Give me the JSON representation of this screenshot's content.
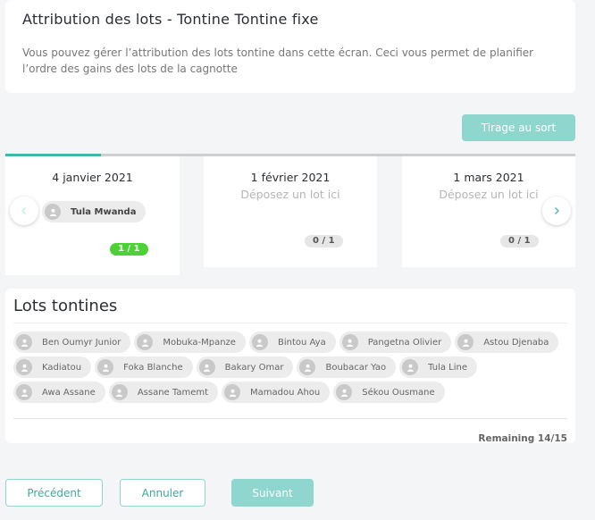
{
  "header": {
    "title": "Attribution des lots - Tontine Tontine fixe",
    "description": "Vous pouvez gérer l’attribution des lots tontine dans cette écran. Ceci vous permet de planifier l’ordre des gains des lots de la cagnotte"
  },
  "actions": {
    "draw_label": "Tirage au sort"
  },
  "progress": {
    "fraction": 0.167
  },
  "lots": [
    {
      "date": "4 janvier 2021",
      "assignee": "Tula Mwanda",
      "count": "1 / 1"
    },
    {
      "date": "1 février 2021",
      "drop_hint": "Déposez un lot ici",
      "count": "0 / 1"
    },
    {
      "date": "1 mars 2021",
      "drop_hint": "Déposez un lot ici",
      "count": "0 / 1"
    }
  ],
  "pool": {
    "title": "Lots tontines",
    "members": [
      "Ben Oumyr Junior",
      "Mobuka-Mpanze",
      "Bintou Aya",
      "Pangetna Olivier",
      "Astou Djenaba",
      "Kadiatou",
      "Foka Blanche",
      "Bakary Omar",
      "Boubacar Yao",
      "Tula Line",
      "Awa Assane",
      "Assane Tamemt",
      "Mamadou Ahou",
      "Sékou Ousmane"
    ],
    "remaining": "Remaining 14/15"
  },
  "footer": {
    "previous_label": "Précédent",
    "cancel_label": "Annuler",
    "next_label": "Suivant"
  },
  "icons": {
    "avatar": "user-icon",
    "prev": "chevron-left-icon",
    "next": "chevron-right-icon"
  },
  "colors": {
    "accent": "#3fb8a9",
    "accent_light": "#8fd6cf",
    "full_badge": "#4cd137"
  }
}
